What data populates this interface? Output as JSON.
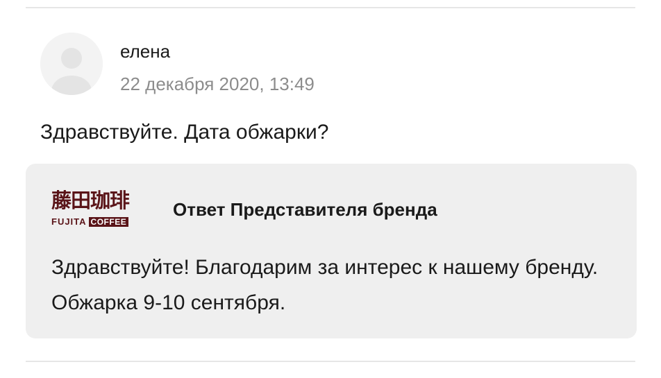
{
  "comment": {
    "author": "елена",
    "date": "22 декабря 2020, 13:49",
    "text": "Здравствуйте. Дата обжарки?"
  },
  "reply": {
    "brand_logo": {
      "kanji": "藤田珈琲",
      "fujita": "FUJITA",
      "coffee": "COFFEE",
      "color": "#5a1418"
    },
    "title": "Ответ Представителя бренда",
    "text": "Здравствуйте! Благодарим за интерес к нашему бренду. Обжарка 9-10 сентября."
  },
  "colors": {
    "reply_background": "#efefef",
    "secondary_text": "#8c8c8c",
    "divider": "#e6e6e6"
  }
}
